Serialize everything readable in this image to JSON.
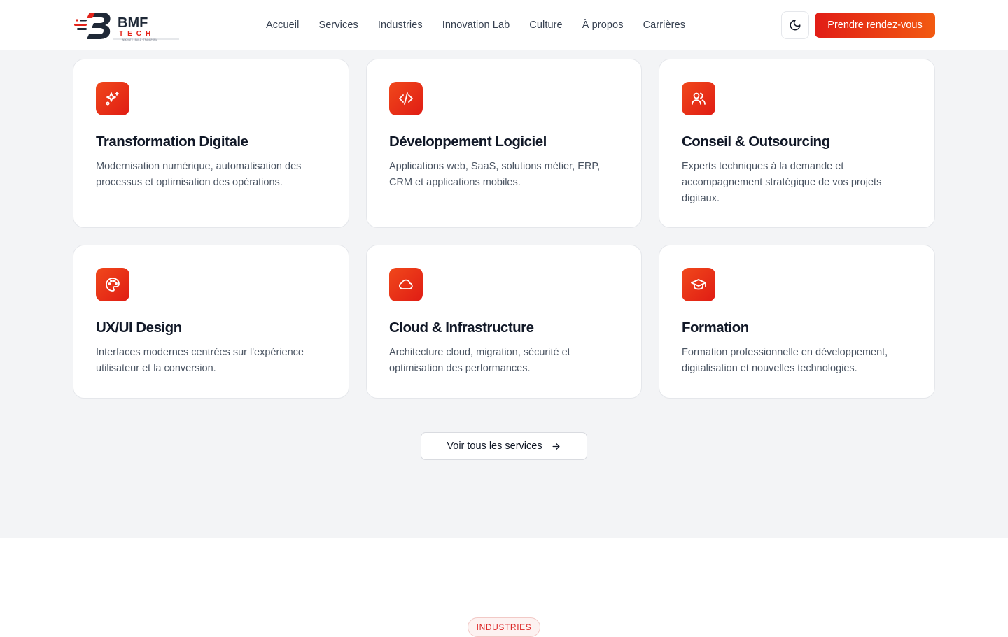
{
  "brand": {
    "name": "BMF",
    "sub": "TECH",
    "tagline": "INNOVATE · BUILD · TRANSFORM",
    "accent": "#e3231a",
    "accent_end": "#f25a11"
  },
  "nav": {
    "items": [
      "Accueil",
      "Services",
      "Industries",
      "Innovation Lab",
      "Culture",
      "À propos",
      "Carrières"
    ]
  },
  "header": {
    "theme_icon": "moon-icon",
    "cta_label": "Prendre rendez-vous"
  },
  "services": {
    "cards": [
      {
        "icon": "sparkles-icon",
        "title": "Transformation Digitale",
        "description": "Modernisation numérique, automatisation des processus et optimisation des opérations."
      },
      {
        "icon": "code-icon",
        "title": "Développement Logiciel",
        "description": "Applications web, SaaS, solutions métier, ERP, CRM et applications mobiles."
      },
      {
        "icon": "users-icon",
        "title": "Conseil & Outsourcing",
        "description": "Experts techniques à la demande et accompagnement stratégique de vos projets digitaux."
      },
      {
        "icon": "palette-icon",
        "title": "UX/UI Design",
        "description": "Interfaces modernes centrées sur l'expérience utilisateur et la conversion."
      },
      {
        "icon": "cloud-icon",
        "title": "Cloud & Infrastructure",
        "description": "Architecture cloud, migration, sécurité et optimisation des performances."
      },
      {
        "icon": "graduation-cap-icon",
        "title": "Formation",
        "description": "Formation professionnelle en développement, digitalisation et nouvelles technologies."
      }
    ],
    "view_all_label": "Voir tous les services"
  },
  "industries": {
    "badge": "INDUSTRIES"
  }
}
